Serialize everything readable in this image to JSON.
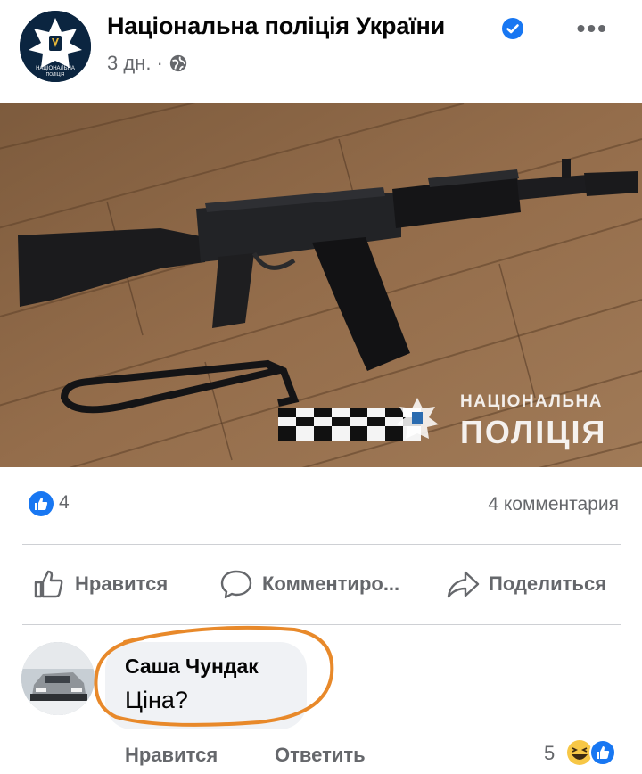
{
  "post": {
    "page_name": "Національна поліція України",
    "time": "3 дн.",
    "separator": "·",
    "more": "•••"
  },
  "photo": {
    "watermark_top": "НАЦІОНАЛЬНА",
    "watermark_bottom": "ПОЛІЦІЯ",
    "logo_text": "НАЦІОНАЛЬНА ПОЛІЦІЯ"
  },
  "stats": {
    "like_count": "4",
    "comment_count": "4 комментария"
  },
  "actions": {
    "like": "Нравится",
    "comment": "Комментиро...",
    "share": "Поделиться"
  },
  "comment": {
    "author": "Саша Чундак",
    "text": "Ціна?",
    "like": "Нравится",
    "reply": "Ответить",
    "reaction_count": "5"
  },
  "colors": {
    "facebook_blue": "#1877f2",
    "secondary_text": "#65676b",
    "annotation_orange": "#e8892a",
    "floor_wood": "#8a6544"
  },
  "icons": {
    "verified": "verified-badge-icon",
    "globe": "globe-icon",
    "like": "thumbs-up-icon",
    "comment": "comment-bubble-icon",
    "share": "share-arrow-icon",
    "reaction_haha": "haha-emoji-icon"
  }
}
